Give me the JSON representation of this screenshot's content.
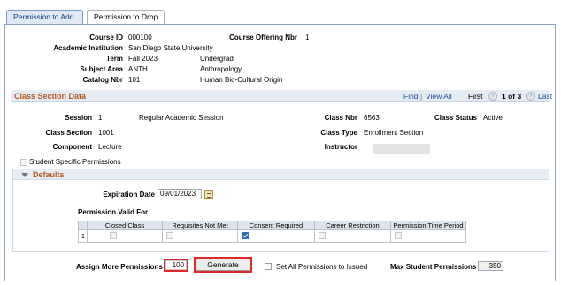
{
  "tabs": [
    {
      "label": "Permission to Add",
      "active": true
    },
    {
      "label": "Permission to Drop",
      "active": false
    }
  ],
  "header": {
    "course_id_label": "Course ID",
    "course_id": "000100",
    "course_offering_label": "Course Offering Nbr",
    "course_offering": "1",
    "institution_label": "Academic Institution",
    "institution": "San Diego State University",
    "term_label": "Term",
    "term": "Fall 2023",
    "career": "Undergrad",
    "subject_label": "Subject Area",
    "subject": "ANTH",
    "subject_desc": "Anthropology",
    "catalog_label": "Catalog Nbr",
    "catalog": "101",
    "catalog_desc": "Human Bio-Cultural Origin"
  },
  "class_section": {
    "title": "Class Section Data",
    "find": "Find",
    "separator": "|",
    "view_all": "View All",
    "first": "First",
    "prev_icon": "‹",
    "count": "1 of 3",
    "next_icon": "›",
    "last": "Last",
    "session_label": "Session",
    "session": "1",
    "session_desc": "Regular Academic Session",
    "class_nbr_label": "Class Nbr",
    "class_nbr": "6563",
    "status_label": "Class Status",
    "status": "Active",
    "section_label": "Class Section",
    "section": "1001",
    "class_type_label": "Class Type",
    "class_type": "Enrollment Section",
    "component_label": "Component",
    "component": "Lecture",
    "instructor_label": "Instructor",
    "student_specific_label": "Student Specific Permissions"
  },
  "defaults": {
    "title": "Defaults",
    "expiration_label": "Expiration Date",
    "expiration": "09/01/2023",
    "permission_valid_label": "Permission Valid For",
    "columns": [
      "Closed Class",
      "Requisites Not Met",
      "Consent Required",
      "Career Restriction",
      "Permission Time Period"
    ],
    "row_number": "1",
    "checked": [
      false,
      false,
      true,
      false,
      false
    ]
  },
  "bottom": {
    "assign_label": "Assign More Permissions",
    "assign_value": "100",
    "generate_label": "Generate",
    "set_all_label": "Set All Permissions to Issued",
    "max_label": "Max Student Permissions",
    "max_value": "350"
  },
  "colors": {
    "section_title": "#b8551d",
    "link": "#1c4ea0",
    "highlight": "#dd2b2b",
    "checkbox": "#2f6fbd"
  }
}
